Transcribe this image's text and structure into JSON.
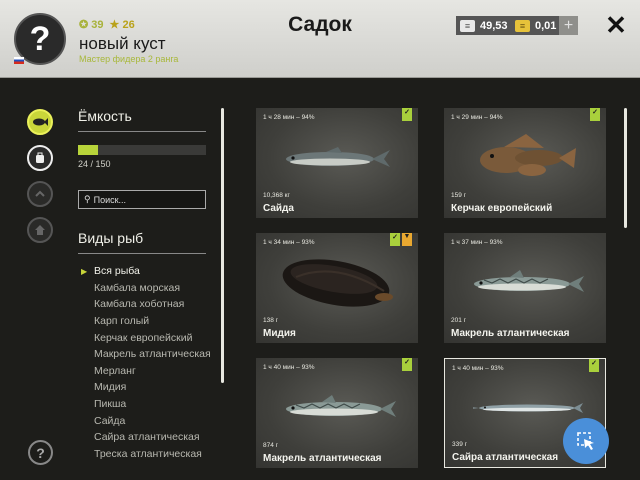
{
  "header": {
    "avatar_glyph": "?",
    "coins": "39",
    "stars": "26",
    "player_name": "новый куст",
    "player_rank": "Мастер фидера 2 ранга",
    "title": "Садок",
    "silver": "49,53",
    "gold": "0,01",
    "plus": "+",
    "close": "✕"
  },
  "rail": {
    "help": "?"
  },
  "sidebar": {
    "capacity_label": "Ёмкость",
    "capacity_count": "24 / 150",
    "capacity_fraction": 0.16,
    "search_placeholder": "Поиск...",
    "species_title": "Виды рыб",
    "species": [
      "Вся рыба",
      "Камбала морская",
      "Камбала хоботная",
      "Карп голый",
      "Керчак европейский",
      "Макрель атлантическая",
      "Мерланг",
      "Мидия",
      "Пикша",
      "Сайда",
      "Сайра атлантическая",
      "Треска атлантическая"
    ],
    "active_index": 0
  },
  "cards": [
    {
      "time": "1 ч 28 мин – 94%",
      "weight": "10,368 кг",
      "name": "Сайда",
      "badges": [
        "green"
      ],
      "fish": "pollock"
    },
    {
      "time": "1 ч 29 мин – 94%",
      "weight": "159 г",
      "name": "Керчак европейский",
      "badges": [
        "green"
      ],
      "fish": "sculpin"
    },
    {
      "time": "1 ч 34 мин – 93%",
      "weight": "138 г",
      "name": "Мидия",
      "badges": [
        "green",
        "orange"
      ],
      "fish": "mussel"
    },
    {
      "time": "1 ч 37 мин – 93%",
      "weight": "201 г",
      "name": "Макрель атлантическая",
      "badges": [],
      "fish": "mackerel"
    },
    {
      "time": "1 ч 40 мин – 93%",
      "weight": "874 г",
      "name": "Макрель атлантическая",
      "badges": [
        "green"
      ],
      "fish": "mackerel"
    },
    {
      "time": "1 ч 40 мин – 93%",
      "weight": "339 г",
      "name": "Сайра атлантическая",
      "badges": [
        "green"
      ],
      "fish": "saury"
    }
  ],
  "colors": {
    "accent_green": "#b8d43a",
    "badge_orange": "#e9a830",
    "fab_blue": "#4a8fd9"
  }
}
